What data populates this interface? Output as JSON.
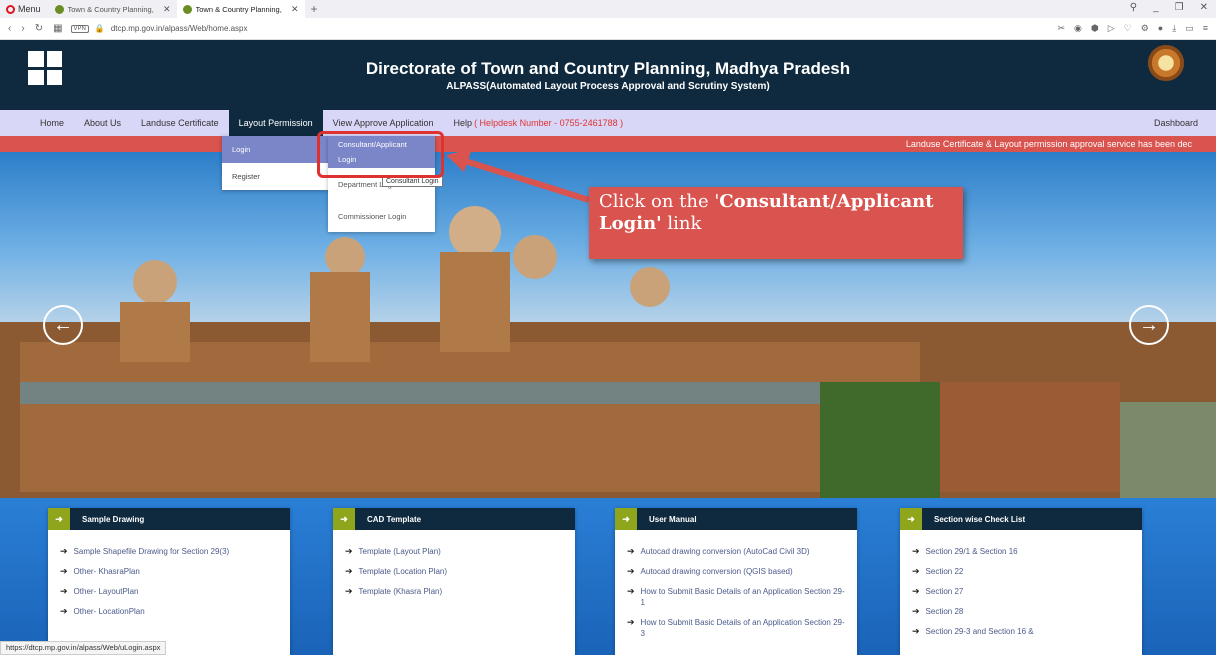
{
  "browser": {
    "menu_label": "Menu",
    "tabs": [
      {
        "title": "Town & Country Planning,"
      },
      {
        "title": "Town & Country Planning,"
      }
    ],
    "vpn_label": "VPN",
    "url": "dtcp.mp.gov.in/alpass/Web/home.aspx",
    "status_url": "https://dtcp.mp.gov.in/alpass/Web/uLogin.aspx"
  },
  "header": {
    "title": "Directorate of Town and Country Planning, Madhya Pradesh",
    "subtitle": "ALPASS(Automated Layout Process Approval and Scrutiny System)"
  },
  "menu": {
    "items": [
      "Home",
      "About Us",
      "Landuse Certificate",
      "Layout Permission",
      "View Approve Application",
      "Help"
    ],
    "helpdesk": "( Helpdesk Number - 0755-2461788 )",
    "dashboard": "Dashboard"
  },
  "ticker": "Landuse Certificate & Layout permission approval service has been dec",
  "dropdown": {
    "level1": [
      "Login",
      "Register"
    ],
    "level2": {
      "consultant_line1": "Consultant/Applicant",
      "consultant_line2": "Login",
      "department": "Department Login",
      "commissioner": "Commissioner Login"
    },
    "tooltip": "Consultant Login"
  },
  "callout": {
    "prefix": "Click on the '",
    "bold": "Consultant/Applicant Login'",
    "suffix": " link"
  },
  "cards": [
    {
      "title": "Sample Drawing",
      "items": [
        "Sample Shapefile Drawing for Section 29(3)",
        "Other- KhasraPlan",
        "Other- LayoutPlan",
        "Other- LocationPlan"
      ]
    },
    {
      "title": "CAD Template",
      "items": [
        "Template (Layout Plan)",
        "Template (Location Plan)",
        "Template (Khasra Plan)"
      ]
    },
    {
      "title": "User Manual",
      "items": [
        "Autocad drawing conversion (AutoCad Civil 3D)",
        "Autocad drawing conversion (QGIS based)",
        "How to Submit Basic Details of an Application Section 29-1",
        "How to Submit Basic Details of an Application Section 29-3"
      ]
    },
    {
      "title": "Section wise Check List",
      "items": [
        "Section 29/1 & Section 16",
        "Section 22",
        "Section 27",
        "Section 28",
        "Section 29-3 and Section 16 &"
      ]
    }
  ],
  "colors": {
    "header_bg": "#0f2a3e",
    "menu_bg": "#d8d7f7",
    "ticker_bg": "#d9534f",
    "highlight": "#e03131",
    "card_icon": "#8fa51c"
  }
}
